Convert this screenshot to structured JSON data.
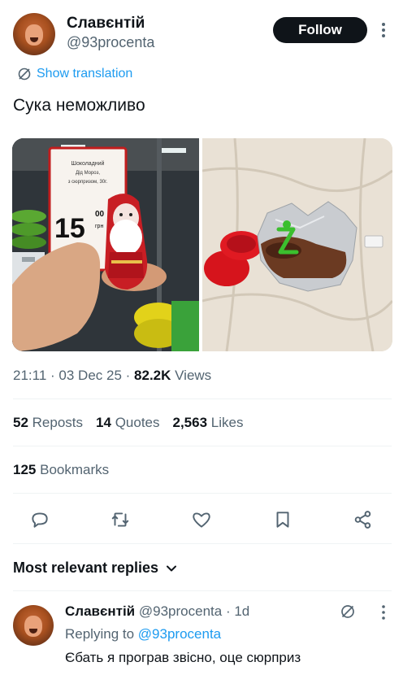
{
  "author": {
    "display_name": "Славєнтій",
    "handle": "@93procenta",
    "follow_label": "Follow"
  },
  "translate_label": "Show translation",
  "tweet_text": "Сука неможливо",
  "photo1": {
    "sign_line1": "Шоколадний",
    "sign_line2": "Дід Мороз,",
    "sign_line3": "з сюрпризом, 30г.",
    "price_big": "15",
    "price_small": "00",
    "price_unit": "грн"
  },
  "meta": {
    "time": "21:11",
    "date": "03 Dec 25",
    "views_count": "82.2K",
    "views_label": "Views"
  },
  "stats": {
    "reposts_count": "52",
    "reposts_label": "Reposts",
    "quotes_count": "14",
    "quotes_label": "Quotes",
    "likes_count": "2,563",
    "likes_label": "Likes",
    "bookmarks_count": "125",
    "bookmarks_label": "Bookmarks"
  },
  "icons": [
    "reply-icon",
    "repost-icon",
    "like-icon",
    "bookmark-icon",
    "share-icon"
  ],
  "replies": {
    "header": "Most relevant replies",
    "items": [
      {
        "display_name": "Славєнтій",
        "handle": "@93procenta",
        "age": "1d",
        "replying_prefix": "Replying to",
        "replying_handle": "@93procenta",
        "text": "Єбать я програв звісно, оце сюрприз"
      }
    ]
  },
  "colors": {
    "accent": "#1d9bf0",
    "text": "#0f1419",
    "muted": "#536471",
    "button_bg": "#0f1419"
  }
}
